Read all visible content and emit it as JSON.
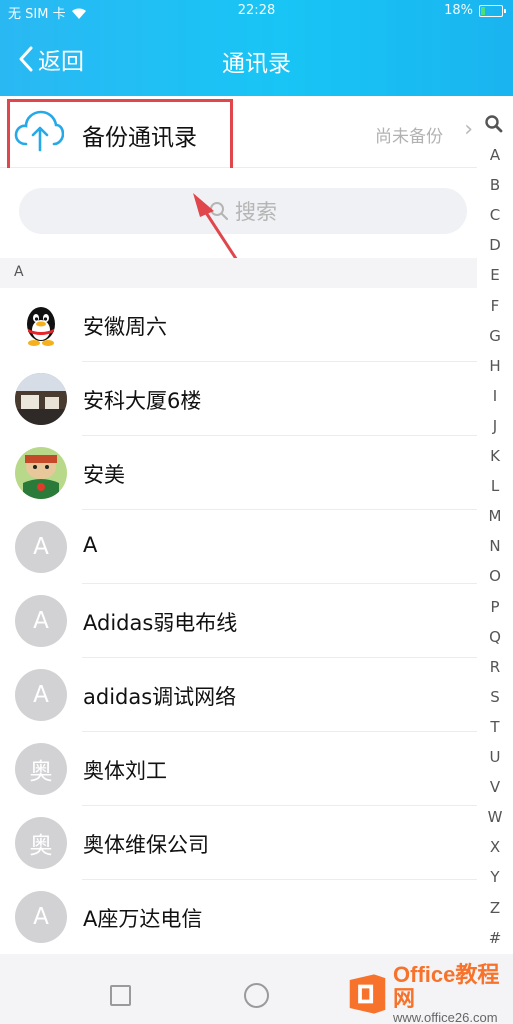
{
  "status_bar": {
    "carrier": "无 SIM 卡",
    "time": "22:28",
    "battery": "18%",
    "battery_level": 0.18
  },
  "nav": {
    "back_label": "返回",
    "title": "通讯录"
  },
  "backup": {
    "label": "备份通讯录",
    "status": "尚未备份"
  },
  "search": {
    "placeholder": "搜索"
  },
  "section": "A",
  "contacts": [
    {
      "name": "安徽周六",
      "avatar": "qq-penguin-avatar"
    },
    {
      "name": "安科大厦6楼",
      "avatar": "photo-avatar"
    },
    {
      "name": "安美",
      "avatar": "cartoon-avatar"
    },
    {
      "name": "A",
      "avatar_letter": "A"
    },
    {
      "name": "Adidas弱电布线",
      "avatar_letter": "A"
    },
    {
      "name": "adidas调试网络",
      "avatar_letter": "A"
    },
    {
      "name": "奥体刘工",
      "avatar_letter": "奥"
    },
    {
      "name": "奥体维保公司",
      "avatar_letter": "奥"
    },
    {
      "name": "A座万达电信",
      "avatar_letter": "A"
    }
  ],
  "alpha_index": [
    "A",
    "B",
    "C",
    "D",
    "E",
    "F",
    "G",
    "H",
    "I",
    "J",
    "K",
    "L",
    "M",
    "N",
    "O",
    "P",
    "Q",
    "R",
    "S",
    "T",
    "U",
    "V",
    "W",
    "X",
    "Y",
    "Z",
    "#"
  ],
  "watermark": {
    "brand": "Office教程网",
    "url": "www.office26.com"
  },
  "colors": {
    "header_start": "#2ab8f3",
    "header_end": "#1ab4f0",
    "highlight": "#e0474c",
    "avatar_gray": "#d2d2d4"
  }
}
